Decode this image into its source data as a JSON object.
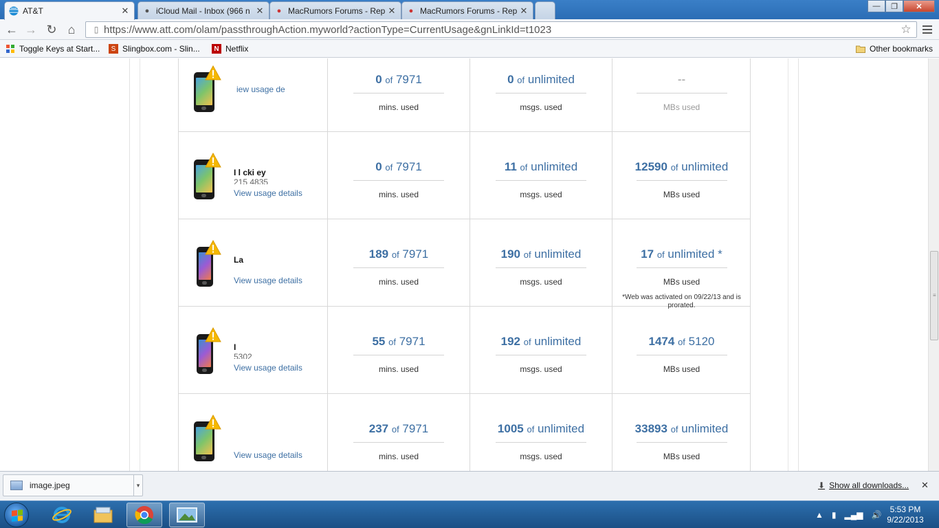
{
  "browser": {
    "tabs": [
      {
        "title": "AT&T",
        "favicon": "att-globe-icon",
        "active": true
      },
      {
        "title": "iCloud Mail - Inbox (966 n",
        "favicon": "apple-icon",
        "active": false
      },
      {
        "title": "MacRumors Forums - Rep",
        "favicon": "macrumors-icon",
        "active": false
      },
      {
        "title": "MacRumors Forums - Rep",
        "favicon": "macrumors-icon",
        "active": false
      }
    ],
    "url": "https://www.att.com/olam/passthroughAction.myworld?actionType=CurrentUsage&gnLinkId=t1023",
    "bookmarks": [
      {
        "label": "Toggle Keys at Start...",
        "icon": "pinwheel-icon"
      },
      {
        "label": "Slingbox.com - Slin...",
        "icon": "slingbox-icon"
      },
      {
        "label": "Netflix",
        "icon": "netflix-icon"
      }
    ],
    "other_bookmarks": "Other bookmarks"
  },
  "usage": {
    "view_link": "View usage details",
    "rows": [
      {
        "name": "",
        "number": "",
        "link": "iew usage de",
        "mins_used": "0",
        "mins_total": "7971",
        "msgs_used": "0",
        "msgs_total": "unlimited",
        "data_used": "--",
        "data_total": "",
        "note": ""
      },
      {
        "name": "I  l    cki   ey",
        "number": "215       4835",
        "link": "View usage details",
        "mins_used": "0",
        "mins_total": "7971",
        "msgs_used": "11",
        "msgs_total": "unlimited",
        "data_used": "12590",
        "data_total": "unlimited",
        "note": ""
      },
      {
        "name": "La",
        "number": "",
        "link": "View usage details",
        "mins_used": "189",
        "mins_total": "7971",
        "msgs_used": "190",
        "msgs_total": "unlimited",
        "data_used": "17",
        "data_total": "unlimited *",
        "note": "*Web was activated on 09/22/13 and is prorated."
      },
      {
        "name": "I",
        "number": "5302",
        "link": "View usage details",
        "mins_used": "55",
        "mins_total": "7971",
        "msgs_used": "192",
        "msgs_total": "unlimited",
        "data_used": "1474",
        "data_total": "5120",
        "note": ""
      },
      {
        "name": "",
        "number": "",
        "link": "View usage details",
        "mins_used": "237",
        "mins_total": "7971",
        "msgs_used": "1005",
        "msgs_total": "unlimited",
        "data_used": "33893",
        "data_total": "unlimited",
        "note": ""
      }
    ],
    "of": "of",
    "mins_label": "mins. used",
    "msgs_label": "msgs. used",
    "data_label": "MBs used"
  },
  "downloads": {
    "file": "image.jpeg",
    "show_all": "Show all downloads..."
  },
  "taskbar": {
    "time": "5:53 PM",
    "date": "9/22/2013"
  },
  "colors": {
    "link_blue": "#3d6fa3",
    "warning_yellow": "#f5b800"
  }
}
